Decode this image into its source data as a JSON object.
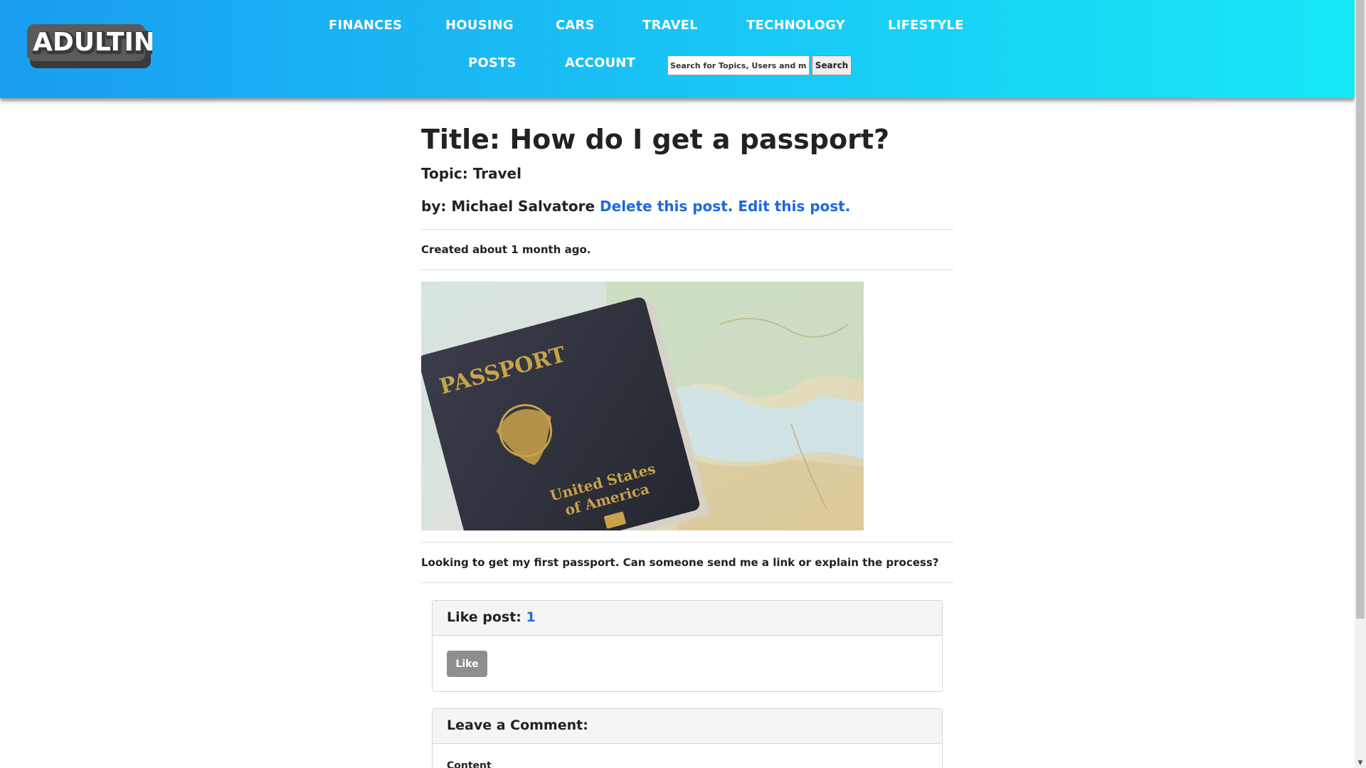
{
  "header": {
    "logo_text": "ADULTING",
    "nav_row1": [
      "FINANCES",
      "HOUSING",
      "CARS",
      "TRAVEL",
      "TECHNOLOGY",
      "LIFESTYLE"
    ],
    "nav_row2": [
      "POSTS",
      "ACCOUNT"
    ],
    "search": {
      "placeholder": "Search for Topics, Users and more",
      "button_label": "Search"
    }
  },
  "post": {
    "title": "Title: How do I get a passport?",
    "topic": "Topic: Travel",
    "author_prefix": "by: Michael Salvatore ",
    "delete_link": "Delete this post.",
    "edit_link": "Edit this post.",
    "created": "Created about 1 month ago.",
    "image": {
      "passport_text": "PASSPORT",
      "country_line1": "United States",
      "country_line2": "of America"
    },
    "body": "Looking to get my first passport. Can someone send me a link or explain the process?"
  },
  "like_panel": {
    "heading": "Like post: ",
    "count": "1",
    "button_label": "Like"
  },
  "comment_panel": {
    "heading": "Leave a Comment:",
    "content_label": "Content"
  },
  "colors": {
    "link": "#1d68e0",
    "header_start": "#1a9df0",
    "header_end": "#17e8f7"
  }
}
